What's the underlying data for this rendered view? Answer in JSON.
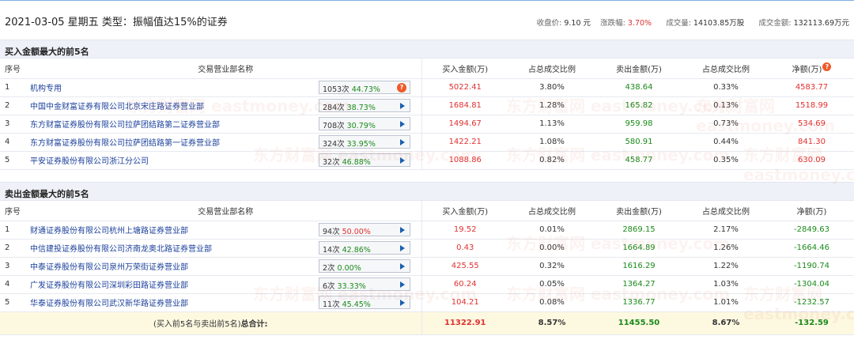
{
  "header": {
    "title": "2021-03-05 星期五  类型：振幅值达15%的证券",
    "close_label": "收盘价:",
    "close_value": "9.10 元",
    "change_label": "涨跌幅:",
    "change_value": "3.70%",
    "volume_label": "成交量:",
    "volume_value": "14103.85万股",
    "amount_label": "成交金额:",
    "amount_value": "132113.69万元"
  },
  "buy_section": {
    "title": "买入金额最大的前5名",
    "headers": [
      "序号",
      "交易营业部名称",
      "买入金额(万)",
      "占总成交比例",
      "卖出金额(万)",
      "占总成交比例",
      "净额(万)"
    ],
    "rows": [
      {
        "idx": "1",
        "name": "机构专用",
        "count": "1053次",
        "pct": "44.73%",
        "pct_color": "green",
        "badge": "?",
        "buy": "5022.41",
        "buy_ratio": "3.80%",
        "sell": "438.64",
        "sell_ratio": "0.33%",
        "net": "4583.77"
      },
      {
        "idx": "2",
        "name": "中国中金财富证券有限公司北京宋庄路证券营业部",
        "count": "284次",
        "pct": "38.73%",
        "pct_color": "green",
        "buy": "1684.81",
        "buy_ratio": "1.28%",
        "sell": "165.82",
        "sell_ratio": "0.13%",
        "net": "1518.99"
      },
      {
        "idx": "3",
        "name": "东方财富证券股份有限公司拉萨团结路第二证券营业部",
        "count": "708次",
        "pct": "30.79%",
        "pct_color": "green",
        "buy": "1494.67",
        "buy_ratio": "1.13%",
        "sell": "959.98",
        "sell_ratio": "0.73%",
        "net": "534.69"
      },
      {
        "idx": "4",
        "name": "东方财富证券股份有限公司拉萨团结路第一证券营业部",
        "count": "324次",
        "pct": "33.95%",
        "pct_color": "green",
        "buy": "1422.21",
        "buy_ratio": "1.08%",
        "sell": "580.91",
        "sell_ratio": "0.44%",
        "net": "841.30"
      },
      {
        "idx": "5",
        "name": "平安证券股份有限公司浙江分公司",
        "count": "32次",
        "pct": "46.88%",
        "pct_color": "green",
        "buy": "1088.86",
        "buy_ratio": "0.82%",
        "sell": "458.77",
        "sell_ratio": "0.35%",
        "net": "630.09"
      }
    ]
  },
  "sell_section": {
    "title": "卖出金额最大的前5名",
    "headers": [
      "序号",
      "交易营业部名称",
      "买入金额(万)",
      "占总成交比例",
      "卖出金额(万)",
      "占总成交比例",
      "净额(万)"
    ],
    "rows": [
      {
        "idx": "1",
        "name": "财通证券股份有限公司杭州上塘路证券营业部",
        "count": "94次",
        "pct": "50.00%",
        "pct_color": "red",
        "buy": "19.52",
        "buy_ratio": "0.01%",
        "sell": "2869.15",
        "sell_ratio": "2.17%",
        "net": "-2849.63"
      },
      {
        "idx": "2",
        "name": "中信建投证券股份有限公司济南龙奥北路证券营业部",
        "count": "14次",
        "pct": "42.86%",
        "pct_color": "green",
        "buy": "0.43",
        "buy_ratio": "0.00%",
        "sell": "1664.89",
        "sell_ratio": "1.26%",
        "net": "-1664.46"
      },
      {
        "idx": "3",
        "name": "中泰证券股份有限公司泉州万荣街证券营业部",
        "count": "2次",
        "pct": "0.00%",
        "pct_color": "green",
        "buy": "425.55",
        "buy_ratio": "0.32%",
        "sell": "1616.29",
        "sell_ratio": "1.22%",
        "net": "-1190.74"
      },
      {
        "idx": "4",
        "name": "广发证券股份有限公司深圳彩田路证券营业部",
        "count": "6次",
        "pct": "33.33%",
        "pct_color": "green",
        "buy": "60.24",
        "buy_ratio": "0.05%",
        "sell": "1364.27",
        "sell_ratio": "1.03%",
        "net": "-1304.04"
      },
      {
        "idx": "5",
        "name": "华泰证券股份有限公司武汉新华路证券营业部",
        "count": "11次",
        "pct": "45.45%",
        "pct_color": "green",
        "buy": "104.21",
        "buy_ratio": "0.08%",
        "sell": "1336.77",
        "sell_ratio": "1.01%",
        "net": "-1232.57"
      }
    ],
    "total": {
      "label_prefix": "(买入前5名与卖出前5名)",
      "label_bold": "总合计:",
      "buy": "11322.91",
      "buy_ratio": "8.57%",
      "sell": "11455.50",
      "sell_ratio": "8.67%",
      "net": "-132.59"
    }
  },
  "watermark": "东方财富网 eastmoney.com",
  "colors": {
    "up": "#e03030",
    "down": "#1a8a1a",
    "link": "#1a3f9a",
    "section_bg": "#eef1f7",
    "total_bg": "#fdf8e0"
  }
}
